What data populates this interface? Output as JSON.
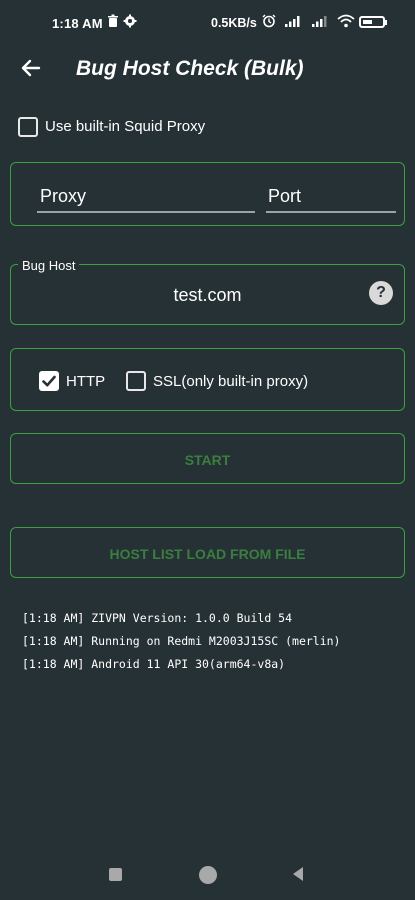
{
  "status_bar": {
    "time": "1:18 AM",
    "speed": "0.5KB/s"
  },
  "toolbar": {
    "title": "Bug Host Check (Bulk)",
    "back_icon": "arrow-left-icon"
  },
  "squid_proxy": {
    "label": "Use built-in Squid Proxy",
    "checked": false
  },
  "proxy_form": {
    "proxy_placeholder": "Proxy",
    "port_placeholder": "Port"
  },
  "bug_host": {
    "label": "Bug Host",
    "value": "test.com",
    "help_icon": "?"
  },
  "protocols": {
    "http_label": "HTTP",
    "http_checked": true,
    "ssl_label": "SSL(only built-in proxy)",
    "ssl_checked": false
  },
  "actions": {
    "start_label": "START",
    "load_label": "HOST LIST LOAD FROM FILE"
  },
  "log": [
    "[1:18 AM] ZIVPN Version: 1.0.0 Build 54",
    "[1:18 AM] Running on Redmi M2003J15SC (merlin)",
    "[1:18 AM] Android 11 API 30(arm64-v8a)"
  ],
  "colors": {
    "background": "#263135",
    "accent_border": "#39a13f",
    "button_text": "#3b7e3f"
  }
}
